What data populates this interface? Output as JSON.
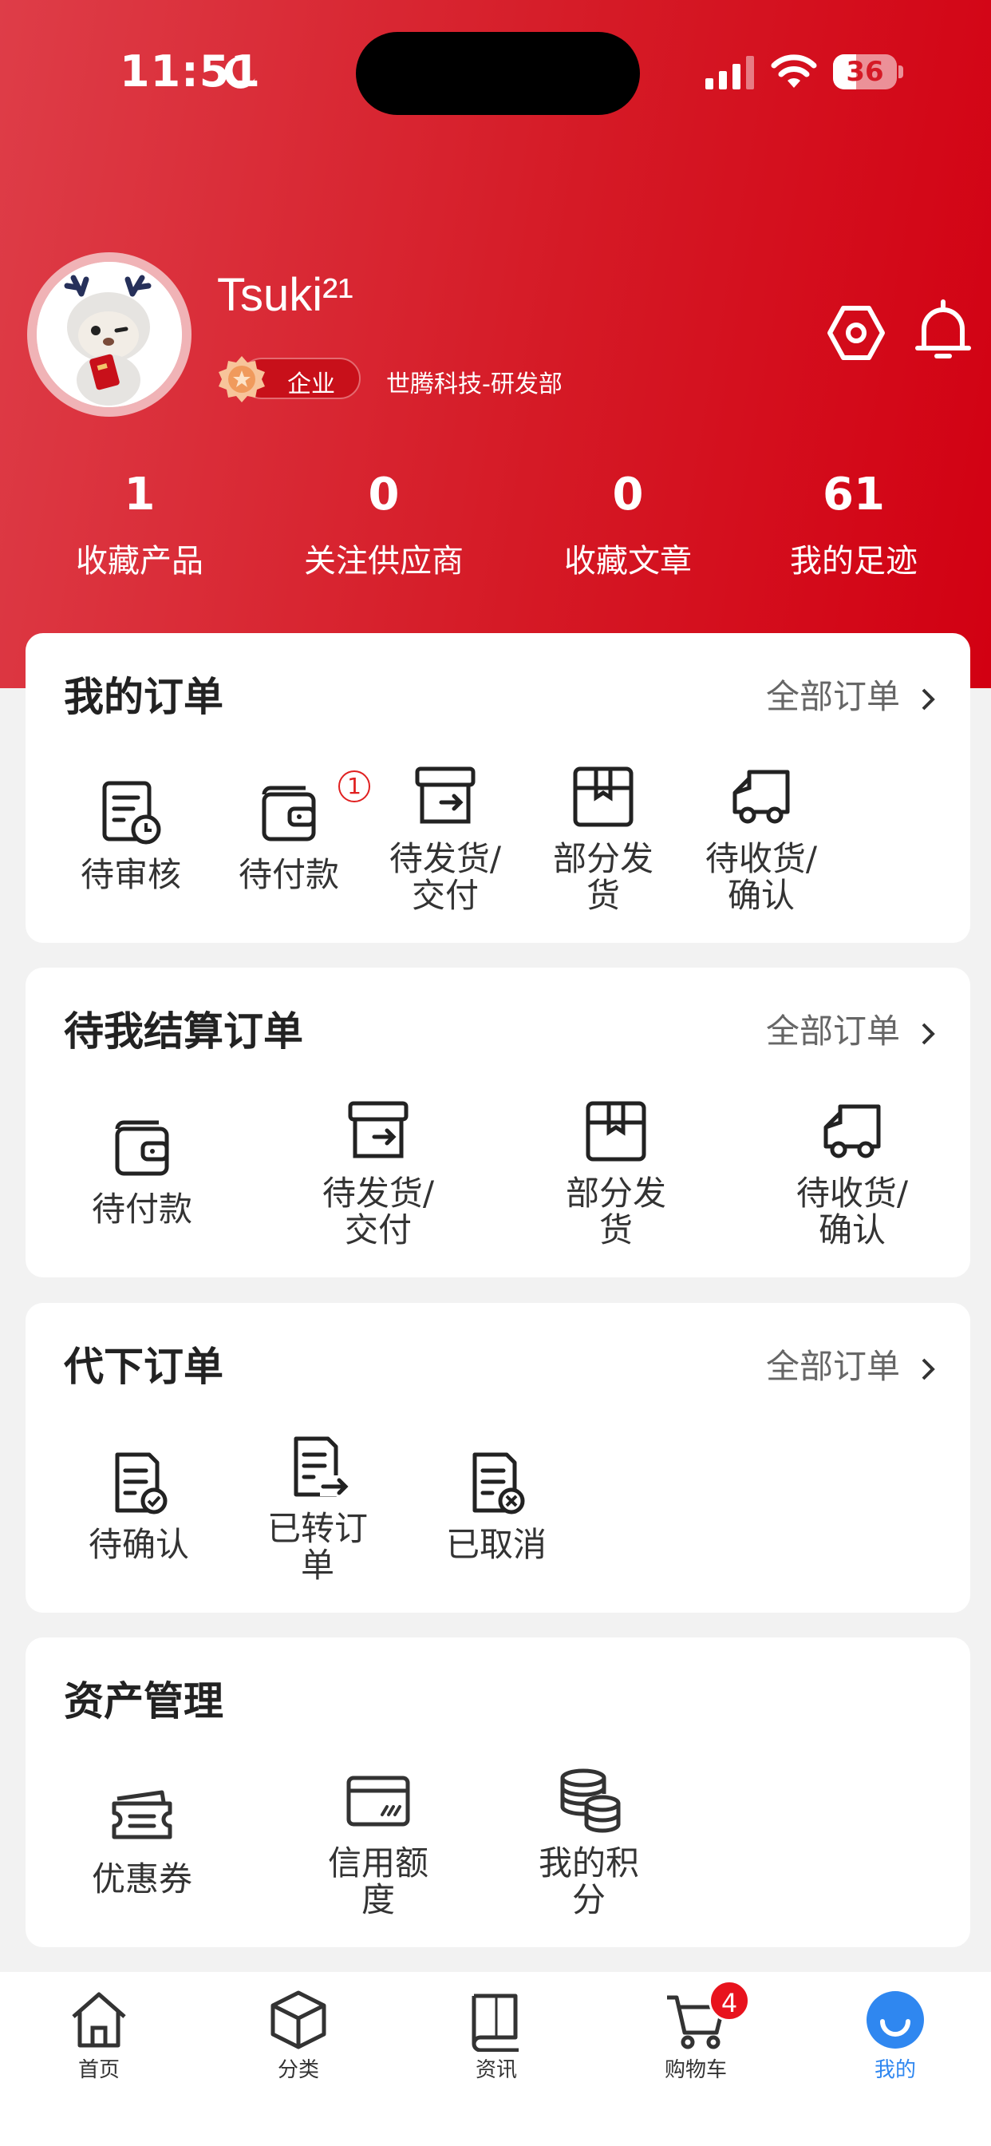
{
  "status_bar": {
    "time": "11:51",
    "battery": "36",
    "battery_level": 0.36
  },
  "profile": {
    "username": "Tsuki²¹",
    "badge": "企业",
    "company": "世腾科技-研发部"
  },
  "stats": [
    {
      "value": "1",
      "label": "收藏产品"
    },
    {
      "value": "0",
      "label": "关注供应商"
    },
    {
      "value": "0",
      "label": "收藏文章"
    },
    {
      "value": "61",
      "label": "我的足迹"
    }
  ],
  "my_orders": {
    "title": "我的订单",
    "more": "全部订单",
    "items": [
      {
        "label": "待审核",
        "icon": "doc-clock-icon"
      },
      {
        "label": "待付款",
        "icon": "wallet-icon",
        "badge": "1"
      },
      {
        "label": "待发货/\n交付",
        "icon": "box-arrow-icon"
      },
      {
        "label": "部分发\n货",
        "icon": "package-icon"
      },
      {
        "label": "待收货/\n确认",
        "icon": "truck-icon"
      }
    ]
  },
  "settle_orders": {
    "title": "待我结算订单",
    "more": "全部订单",
    "items": [
      {
        "label": "待付款",
        "icon": "wallet-icon"
      },
      {
        "label": "待发货/\n交付",
        "icon": "box-arrow-icon"
      },
      {
        "label": "部分发\n货",
        "icon": "package-icon"
      },
      {
        "label": "待收货/\n确认",
        "icon": "truck-icon"
      }
    ]
  },
  "proxy_orders": {
    "title": "代下订单",
    "more": "全部订单",
    "items": [
      {
        "label": "待确认",
        "icon": "doc-check-icon"
      },
      {
        "label": "已转订\n单",
        "icon": "doc-arrow-icon"
      },
      {
        "label": "已取消",
        "icon": "doc-cancel-icon"
      }
    ]
  },
  "assets": {
    "title": "资产管理",
    "items": [
      {
        "label": "优惠券",
        "icon": "coupon-icon"
      },
      {
        "label": "信用额\n度",
        "icon": "credit-card-icon"
      },
      {
        "label": "我的积\n分",
        "icon": "coins-icon"
      }
    ]
  },
  "tabbar": [
    {
      "label": "首页",
      "icon": "home-icon"
    },
    {
      "label": "分类",
      "icon": "cube-icon"
    },
    {
      "label": "资讯",
      "icon": "book-icon"
    },
    {
      "label": "购物车",
      "icon": "cart-icon",
      "badge": "4"
    },
    {
      "label": "我的",
      "icon": "smile-icon",
      "active": true
    }
  ],
  "colors": {
    "brand_red": "#d51a26",
    "active_blue": "#2f87f0",
    "badge_red": "#e8131d"
  }
}
